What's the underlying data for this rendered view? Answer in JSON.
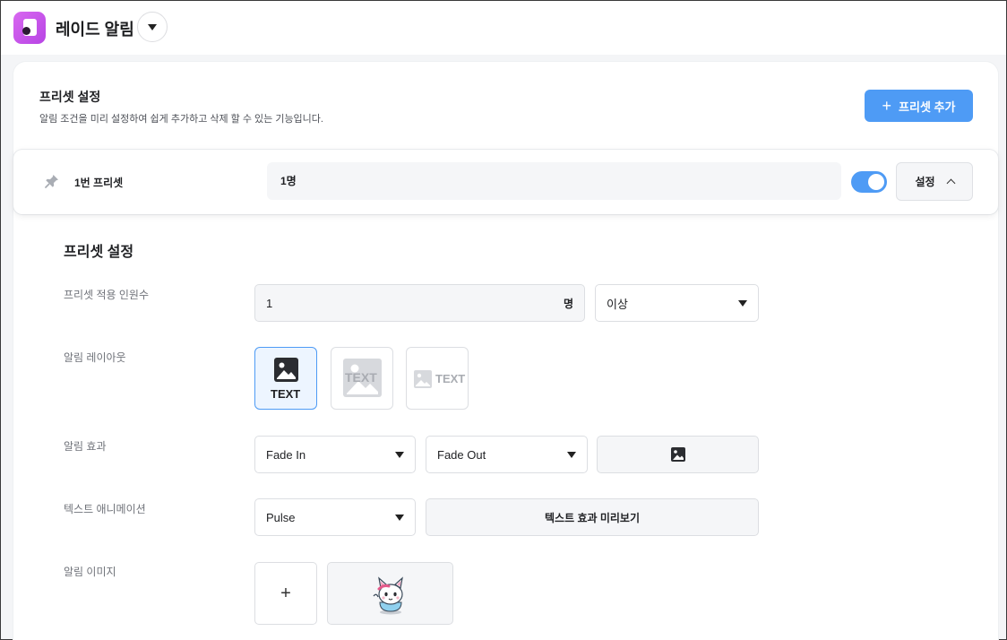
{
  "header": {
    "app_title": "레이드 알림",
    "logo_icon": "user-card-icon",
    "accent": "#c45ae8"
  },
  "preset_section": {
    "title": "프리셋 설정",
    "description": "알림 조건을 미리 설정하여 쉽게 추가하고 삭제 할 수 있는 기능입니다.",
    "add_button_label": "프리셋 추가"
  },
  "preset": {
    "name": "1번 프리셋",
    "count_summary": "1명",
    "enabled": true,
    "settings_label": "설정"
  },
  "form": {
    "title": "프리셋 설정",
    "count": {
      "label": "프리셋 적용 인원수",
      "value": "1",
      "unit": "명",
      "comparator": "이상"
    },
    "layout": {
      "label": "알림 레이아웃",
      "options": [
        {
          "name": "image-above-text",
          "text": "TEXT",
          "selected": true
        },
        {
          "name": "text-over-image",
          "text": "TEXT",
          "selected": false
        },
        {
          "name": "image-beside-text",
          "text": "TEXT",
          "selected": false
        }
      ]
    },
    "effect": {
      "label": "알림 효과",
      "in": "Fade In",
      "out": "Fade Out"
    },
    "text_animation": {
      "label": "텍스트 애니메이션",
      "value": "Pulse",
      "preview_label": "텍스트 효과 미리보기"
    },
    "image": {
      "label": "알림 이미지",
      "add_symbol": "+"
    }
  },
  "colors": {
    "primary": "#4e9bf5",
    "toggle_on": "#4e9bf5"
  }
}
